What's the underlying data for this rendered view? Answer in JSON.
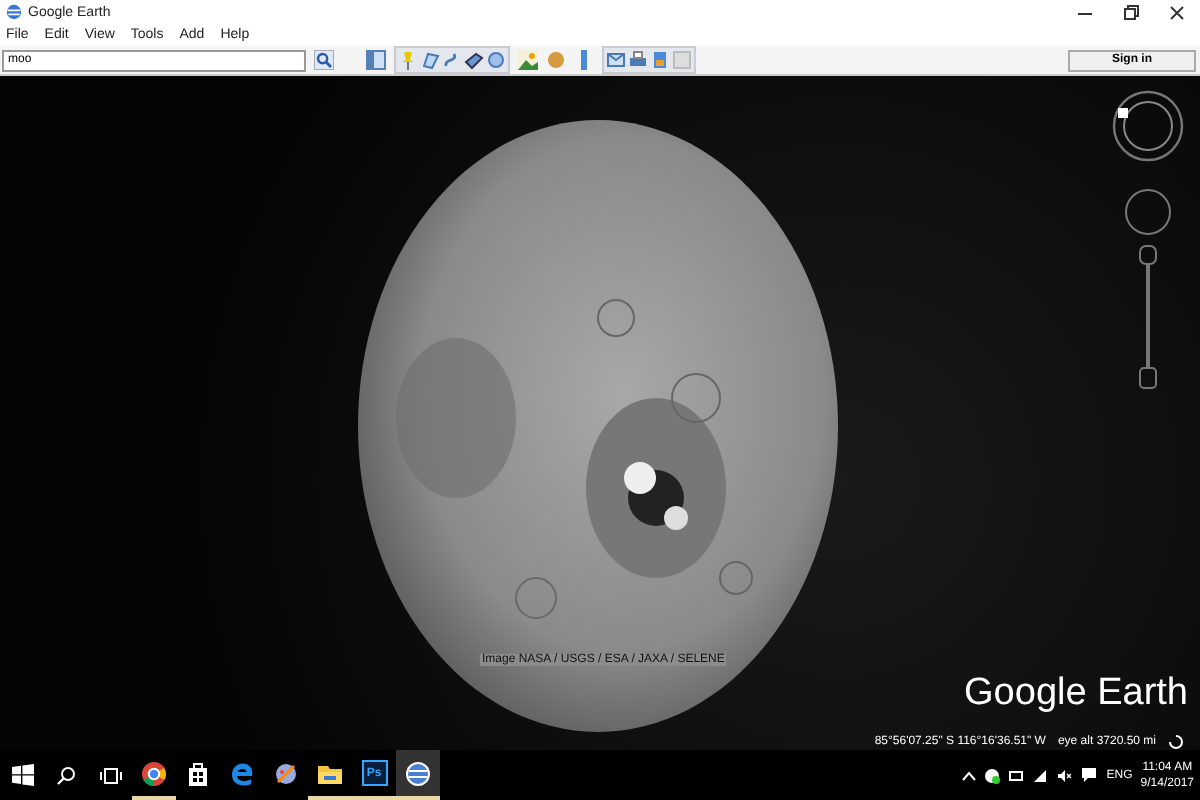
{
  "window": {
    "title": "Google Earth"
  },
  "menu": [
    "File",
    "Edit",
    "View",
    "Tools",
    "Add",
    "Help"
  ],
  "search": {
    "value": "moo"
  },
  "sign_in": "Sign in",
  "viewport": {
    "attribution": "Image NASA / USGS / ESA / JAXA / SELENE",
    "logo": "Google Earth",
    "coordinates": "85°56'07.25\" S  116°16'36.51\" W",
    "eye_alt": "eye alt 3720.50 mi"
  },
  "taskbar": {
    "apps": [
      {
        "kind": "chrome",
        "running": true,
        "selected": false
      },
      {
        "kind": "store",
        "running": false,
        "selected": false
      },
      {
        "kind": "edge",
        "running": false,
        "selected": false
      },
      {
        "kind": "paint",
        "running": false,
        "selected": false
      },
      {
        "kind": "folder",
        "running": true,
        "selected": false
      },
      {
        "kind": "photoshop",
        "label": "Ps",
        "running": true,
        "selected": false
      },
      {
        "kind": "earth",
        "running": true,
        "selected": true
      }
    ],
    "language": "ENG",
    "time": "11:04 AM",
    "date": "9/14/2017"
  }
}
